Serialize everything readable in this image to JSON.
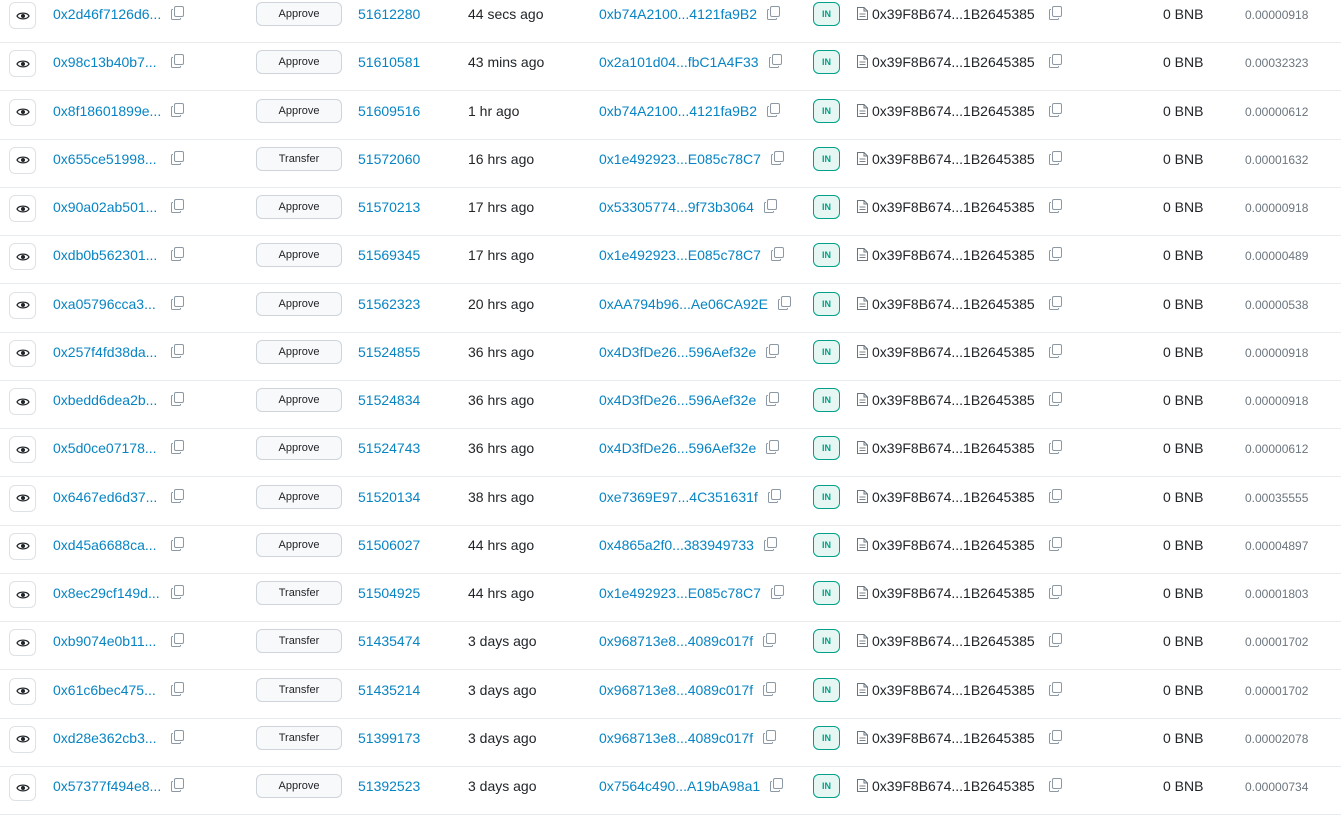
{
  "icons": {
    "view": "eye-icon",
    "copy": "copy-icon",
    "contract": "document-icon"
  },
  "colors": {
    "link": "#0784c3",
    "in_badge": "#00a186"
  },
  "transactions": [
    {
      "hash": "0x2d46f7126d6...",
      "method": "Approve",
      "block": "51612280",
      "age": "44 secs ago",
      "from": "0xb74A2100...4121fa9B2",
      "direction": "IN",
      "to": "0x39F8B674...1B2645385",
      "value": "0 BNB",
      "fee": "0.00000918"
    },
    {
      "hash": "0x98c13b40b7...",
      "method": "Approve",
      "block": "51610581",
      "age": "43 mins ago",
      "from": "0x2a101d04...fbC1A4F33",
      "direction": "IN",
      "to": "0x39F8B674...1B2645385",
      "value": "0 BNB",
      "fee": "0.00032323"
    },
    {
      "hash": "0x8f18601899e...",
      "method": "Approve",
      "block": "51609516",
      "age": "1 hr ago",
      "from": "0xb74A2100...4121fa9B2",
      "direction": "IN",
      "to": "0x39F8B674...1B2645385",
      "value": "0 BNB",
      "fee": "0.00000612"
    },
    {
      "hash": "0x655ce51998...",
      "method": "Transfer",
      "block": "51572060",
      "age": "16 hrs ago",
      "from": "0x1e492923...E085c78C7",
      "direction": "IN",
      "to": "0x39F8B674...1B2645385",
      "value": "0 BNB",
      "fee": "0.00001632"
    },
    {
      "hash": "0x90a02ab501...",
      "method": "Approve",
      "block": "51570213",
      "age": "17 hrs ago",
      "from": "0x53305774...9f73b3064",
      "direction": "IN",
      "to": "0x39F8B674...1B2645385",
      "value": "0 BNB",
      "fee": "0.00000918"
    },
    {
      "hash": "0xdb0b562301...",
      "method": "Approve",
      "block": "51569345",
      "age": "17 hrs ago",
      "from": "0x1e492923...E085c78C7",
      "direction": "IN",
      "to": "0x39F8B674...1B2645385",
      "value": "0 BNB",
      "fee": "0.00000489"
    },
    {
      "hash": "0xa05796cca3...",
      "method": "Approve",
      "block": "51562323",
      "age": "20 hrs ago",
      "from": "0xAA794b96...Ae06CA92E",
      "direction": "IN",
      "to": "0x39F8B674...1B2645385",
      "value": "0 BNB",
      "fee": "0.00000538"
    },
    {
      "hash": "0x257f4fd38da...",
      "method": "Approve",
      "block": "51524855",
      "age": "36 hrs ago",
      "from": "0x4D3fDe26...596Aef32e",
      "direction": "IN",
      "to": "0x39F8B674...1B2645385",
      "value": "0 BNB",
      "fee": "0.00000918"
    },
    {
      "hash": "0xbedd6dea2b...",
      "method": "Approve",
      "block": "51524834",
      "age": "36 hrs ago",
      "from": "0x4D3fDe26...596Aef32e",
      "direction": "IN",
      "to": "0x39F8B674...1B2645385",
      "value": "0 BNB",
      "fee": "0.00000918"
    },
    {
      "hash": "0x5d0ce07178...",
      "method": "Approve",
      "block": "51524743",
      "age": "36 hrs ago",
      "from": "0x4D3fDe26...596Aef32e",
      "direction": "IN",
      "to": "0x39F8B674...1B2645385",
      "value": "0 BNB",
      "fee": "0.00000612"
    },
    {
      "hash": "0x6467ed6d37...",
      "method": "Approve",
      "block": "51520134",
      "age": "38 hrs ago",
      "from": "0xe7369E97...4C351631f",
      "direction": "IN",
      "to": "0x39F8B674...1B2645385",
      "value": "0 BNB",
      "fee": "0.00035555"
    },
    {
      "hash": "0xd45a6688ca...",
      "method": "Approve",
      "block": "51506027",
      "age": "44 hrs ago",
      "from": "0x4865a2f0...383949733",
      "direction": "IN",
      "to": "0x39F8B674...1B2645385",
      "value": "0 BNB",
      "fee": "0.00004897"
    },
    {
      "hash": "0x8ec29cf149d...",
      "method": "Transfer",
      "block": "51504925",
      "age": "44 hrs ago",
      "from": "0x1e492923...E085c78C7",
      "direction": "IN",
      "to": "0x39F8B674...1B2645385",
      "value": "0 BNB",
      "fee": "0.00001803"
    },
    {
      "hash": "0xb9074e0b11...",
      "method": "Transfer",
      "block": "51435474",
      "age": "3 days ago",
      "from": "0x968713e8...4089c017f",
      "direction": "IN",
      "to": "0x39F8B674...1B2645385",
      "value": "0 BNB",
      "fee": "0.00001702"
    },
    {
      "hash": "0x61c6bec475...",
      "method": "Transfer",
      "block": "51435214",
      "age": "3 days ago",
      "from": "0x968713e8...4089c017f",
      "direction": "IN",
      "to": "0x39F8B674...1B2645385",
      "value": "0 BNB",
      "fee": "0.00001702"
    },
    {
      "hash": "0xd28e362cb3...",
      "method": "Transfer",
      "block": "51399173",
      "age": "3 days ago",
      "from": "0x968713e8...4089c017f",
      "direction": "IN",
      "to": "0x39F8B674...1B2645385",
      "value": "0 BNB",
      "fee": "0.00002078"
    },
    {
      "hash": "0x57377f494e8...",
      "method": "Approve",
      "block": "51392523",
      "age": "3 days ago",
      "from": "0x7564c490...A19bA98a1",
      "direction": "IN",
      "to": "0x39F8B674...1B2645385",
      "value": "0 BNB",
      "fee": "0.00000734"
    }
  ]
}
